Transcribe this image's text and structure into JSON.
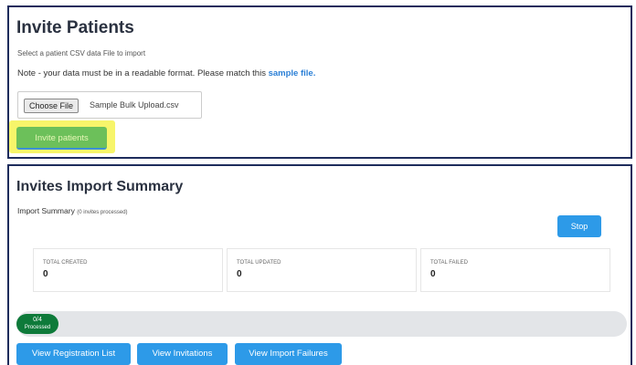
{
  "invite": {
    "title": "Invite Patients",
    "subtitle": "Select a patient CSV data File to import",
    "note_prefix": "Note - your data must be in a readable format. Please match this",
    "note_link": "sample file.",
    "choose_file_label": "Choose File",
    "file_name": "Sample Bulk Upload.csv",
    "invite_button": "Invite patients"
  },
  "summary": {
    "title": "Invites Import Summary",
    "subtitle": "Import Summary",
    "processed_note": "(0 invites processed)",
    "stop_button": "Stop",
    "stats": [
      {
        "label": "TOTAL CREATED",
        "value": "0"
      },
      {
        "label": "TOTAL UPDATED",
        "value": "0"
      },
      {
        "label": "TOTAL FAILED",
        "value": "0"
      }
    ],
    "progress": {
      "count": "0/4",
      "label": "Processed",
      "fraction": 0
    },
    "buttons": {
      "registration_list": "View Registration List",
      "invitations": "View Invitations",
      "import_failures": "View Import Failures"
    }
  },
  "colors": {
    "primary": "#2d9ae8",
    "invite_button": "#6cc05a",
    "highlight": "#f7f56a",
    "progress_pill": "#0e7a3a",
    "panel_border": "#1e2c5c"
  }
}
